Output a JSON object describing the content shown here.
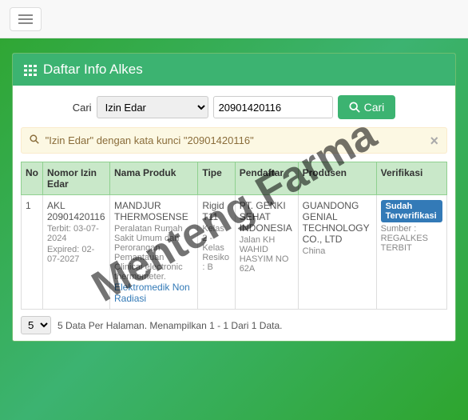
{
  "header": {
    "title": "Daftar Info Alkes"
  },
  "search": {
    "label": "Cari",
    "field_selected": "Izin Edar",
    "query_value": "20901420116",
    "button_label": "Cari"
  },
  "alert": {
    "text": "\"Izin Edar\" dengan kata kunci \"20901420116\""
  },
  "table": {
    "headers": {
      "no": "No",
      "nomor_izin": "Nomor Izin Edar",
      "nama_produk": "Nama Produk",
      "tipe": "Tipe",
      "pendaftar": "Pendaftar",
      "produsen": "Produsen",
      "verifikasi": "Verifikasi"
    },
    "rows": [
      {
        "no": "1",
        "nomor_izin": "AKL 20901420116",
        "terbit": "Terbit: 03-07-2024",
        "expired": "Expired: 02-07-2027",
        "nama_produk": "MANDJUR THERMOSENSE",
        "nama_produk_desc": "Peralatan Rumah Sakit Umum dan Perorangan Pemantauan Clinical electronic thermometer.",
        "nama_produk_link": "Elektromedik Non Radiasi",
        "tipe": "Rigid T11",
        "tipe_desc": "Kelas 2 - Kelas Resiko : B",
        "pendaftar": "PT. GENKI SEHAT INDONESIA",
        "pendaftar_addr": "Jalan KH WAHID HASYIM NO 62A",
        "produsen": "GUANDONG GENIAL TECHNOLOGY CO., LTD",
        "produsen_country": "China",
        "verifikasi_badge": "Sudah Terverifikasi",
        "verifikasi_sumber": "Sumber : REGALKES TERBIT"
      }
    ]
  },
  "pagination": {
    "per_page": "5",
    "info": "5 Data Per Halaman. Menampilkan 1 - 1 Dari 1 Data."
  },
  "watermark": "Menteng Farma"
}
